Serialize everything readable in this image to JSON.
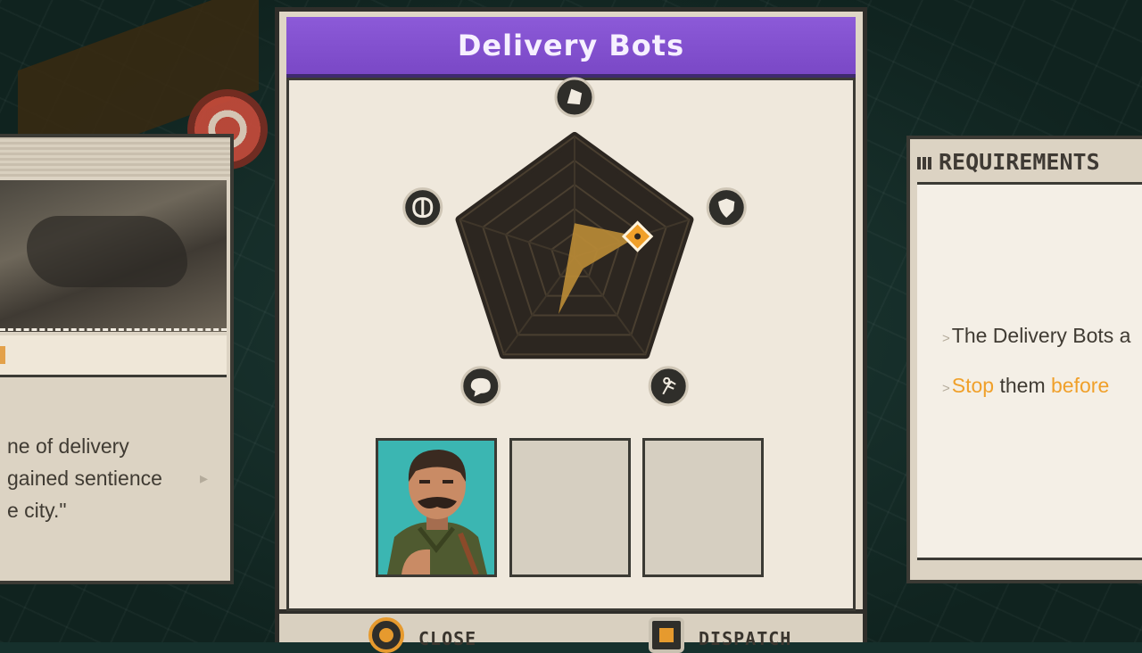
{
  "game": {
    "panel_title": "Delivery Bots",
    "left_card": {
      "description_lines": [
        "ne of delivery",
        " gained sentience",
        "e city.\""
      ]
    },
    "requirements": {
      "title": "REQUIREMENTS",
      "line1": "The Delivery Bots a",
      "line2_highlight_1": "Stop",
      "line2_middle": " them ",
      "line2_highlight_2": "before",
      "line2_end": " "
    },
    "stat_icons": [
      {
        "name": "top-stat-icon"
      },
      {
        "name": "shield-icon"
      },
      {
        "name": "running-icon"
      },
      {
        "name": "speech-bubble-icon"
      },
      {
        "name": "brain-icon"
      }
    ],
    "radar_levels": 5,
    "required_stats": {
      "top": 0.0,
      "shield": 0.55,
      "running": 0.0,
      "speech": 0.0,
      "brain": 0.0
    },
    "highlighted_stat": "shield",
    "agent_slots": [
      {
        "state": "filled",
        "portrait": "mustached-agent-portrait"
      },
      {
        "state": "empty"
      },
      {
        "state": "empty"
      }
    ],
    "buttons": {
      "close": "CLOSE",
      "dispatch": "DISPATCH"
    },
    "colors": {
      "header_purple": "#8c5ad8",
      "accent_orange": "#f0a02a",
      "radar_fill": "#b88a36",
      "portrait_teal": "#3bb6b2"
    }
  }
}
